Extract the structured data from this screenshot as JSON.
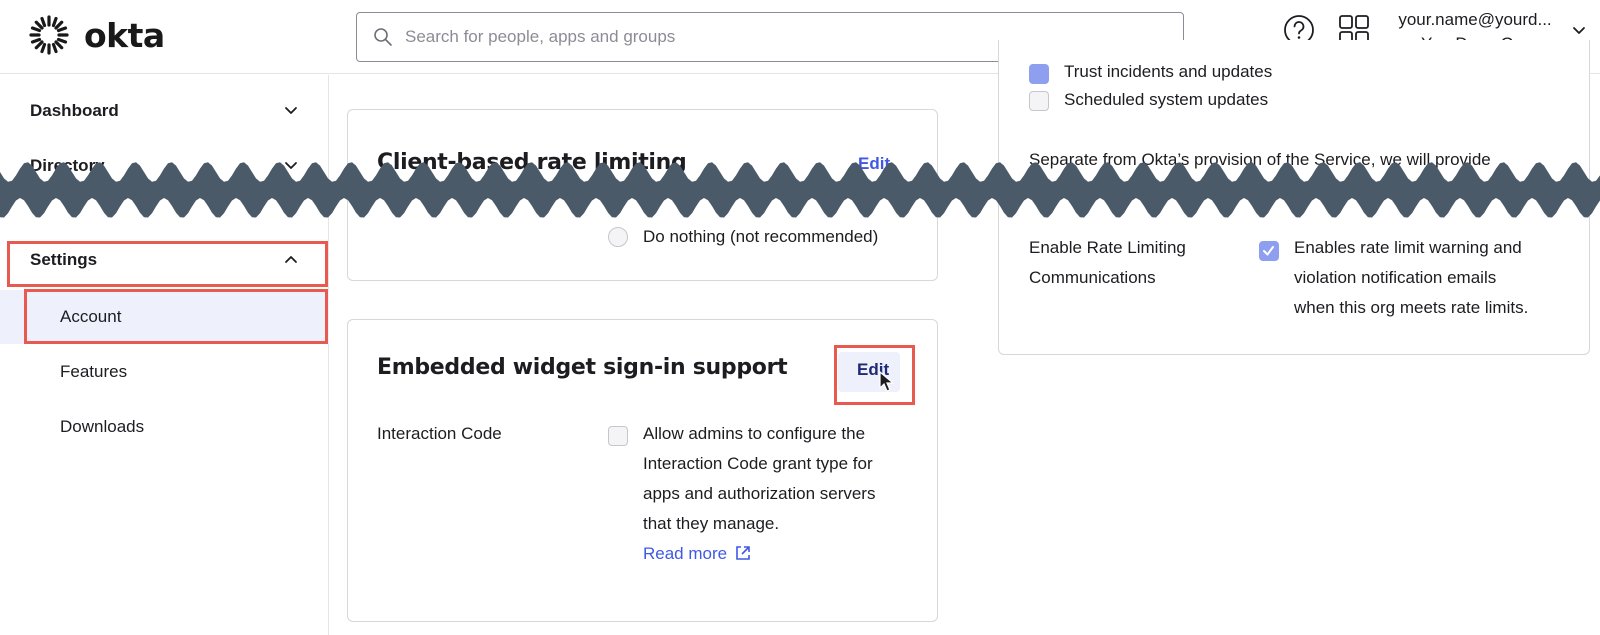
{
  "header": {
    "logo_text": "okta",
    "search_placeholder": "Search for people, apps and groups",
    "user_email": "your.name@yourd...",
    "user_org": "YourDemoOrg"
  },
  "sidebar": {
    "items": [
      {
        "label": "Dashboard"
      },
      {
        "label": "Directory"
      },
      {
        "label": "Settings"
      }
    ],
    "sub_items": [
      {
        "label": "Account"
      },
      {
        "label": "Features"
      },
      {
        "label": "Downloads"
      }
    ]
  },
  "client_rate_card": {
    "title": "Client-based rate limiting",
    "edit_label": "Edit",
    "option_do_nothing": "Do nothing (not recommended)"
  },
  "widget_card": {
    "title": "Embedded widget sign-in support",
    "edit_label": "Edit",
    "field_label": "Interaction Code",
    "description_lines": [
      "Allow admins to configure the",
      "Interaction Code grant type for",
      "apps and authorization servers",
      "that they manage."
    ],
    "read_more": "Read more"
  },
  "notifications_card": {
    "option_trust": "Trust incidents and updates",
    "option_scheduled": "Scheduled system updates",
    "separate_text": "Separate from Okta’s provision of the Service, we will provide",
    "rate_label_lines": [
      "Enable Rate Limiting",
      "Communications"
    ],
    "rate_desc_lines": [
      "Enables rate limit warning and",
      "violation notification emails",
      "when this org meets rate limits."
    ]
  },
  "colors": {
    "accent": "#3f59e4",
    "highlight": "#e85a4f",
    "break_band": "#4a5a68"
  }
}
